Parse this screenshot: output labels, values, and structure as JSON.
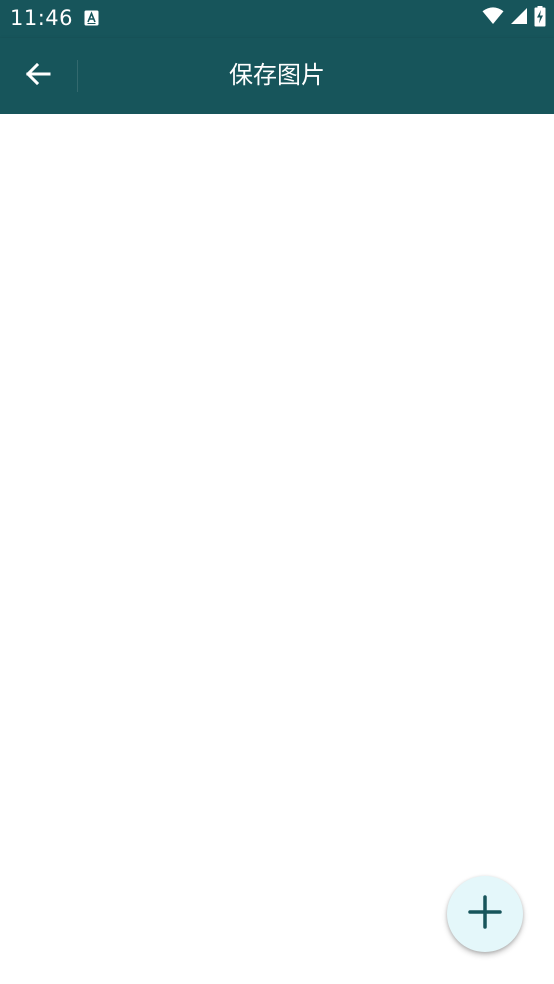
{
  "status_bar": {
    "time": "11:46",
    "icons": [
      "text-notification-icon",
      "wifi-icon",
      "cell-signal-icon",
      "battery-charging-icon"
    ]
  },
  "toolbar": {
    "title": "保存图片",
    "back_icon": "arrow-left-icon"
  },
  "fab": {
    "icon": "plus-icon"
  },
  "colors": {
    "primary": "#17555b",
    "fab_background": "#e4f7fa",
    "fab_icon": "#17555b",
    "background": "#ffffff"
  }
}
